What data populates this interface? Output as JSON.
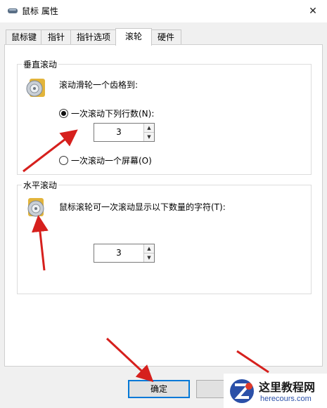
{
  "window": {
    "title": "鼠标 属性",
    "close_icon": "close-icon"
  },
  "tabs": [
    {
      "label": "鼠标键",
      "active": false
    },
    {
      "label": "指针",
      "active": false
    },
    {
      "label": "指针选项",
      "active": false
    },
    {
      "label": "滚轮",
      "active": true
    },
    {
      "label": "硬件",
      "active": false
    }
  ],
  "vertical": {
    "group_label": "垂直滚动",
    "prompt": "滚动滑轮一个齿格到:",
    "option_lines_label": "一次滚动下列行数(N):",
    "option_lines_selected": true,
    "lines_value": "3",
    "option_screen_label": "一次滚动一个屏幕(O)",
    "option_screen_selected": false
  },
  "horizontal": {
    "group_label": "水平滚动",
    "prompt": "鼠标滚轮可一次滚动显示以下数量的字符(T):",
    "chars_value": "3"
  },
  "buttons": {
    "ok_label": "确定"
  },
  "watermark": {
    "title": "这里教程网",
    "url": "herecours.com"
  },
  "colors": {
    "annotation_arrow": "#d6201d",
    "accent": "#0078d7"
  }
}
